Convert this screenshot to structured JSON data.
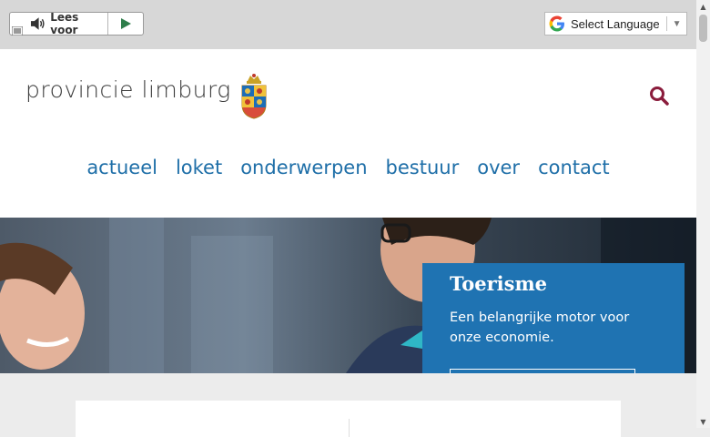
{
  "toolbar": {
    "readspeaker_label": "Lees voor",
    "language_label": "Select Language",
    "language_arrow": "▼"
  },
  "header": {
    "logo_text": "provincie limburg",
    "nav": [
      "actueel",
      "loket",
      "onderwerpen",
      "bestuur",
      "over",
      "contact"
    ]
  },
  "hero": {
    "title": "Toerisme",
    "text": "Een belangrijke motor voor onze economie."
  },
  "colors": {
    "nav": "#1f6fa8",
    "search": "#8a1c3c",
    "hero_card": "#1f73b2"
  }
}
